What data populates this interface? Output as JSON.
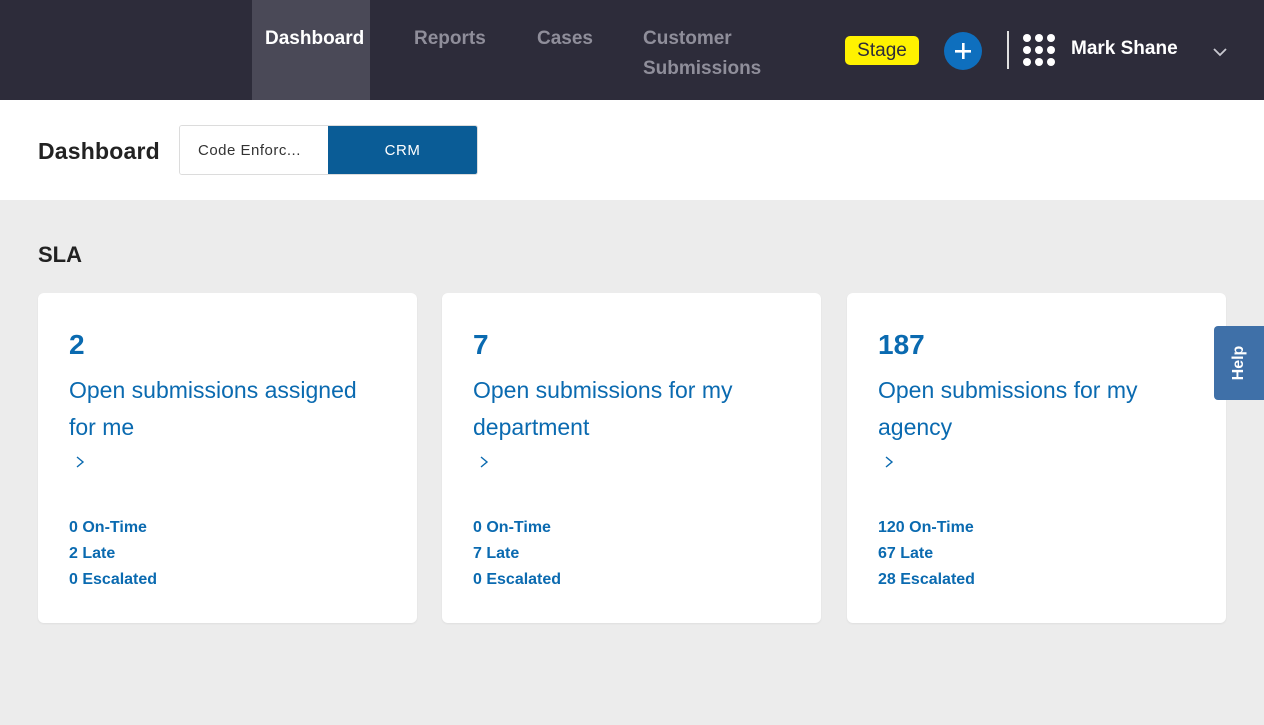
{
  "nav": {
    "tabs": [
      {
        "label": "Dashboard"
      },
      {
        "label": "Reports"
      },
      {
        "label": "Cases"
      },
      {
        "label": "Customer\nSubmissions"
      }
    ],
    "active_tab": "Dashboard",
    "env_badge": "Stage",
    "user_name": "Mark Shane",
    "icons": {
      "add": "plus-icon",
      "apps": "app-grid-icon",
      "menu": "chevron-down-icon"
    }
  },
  "subheader": {
    "title": "Dashboard",
    "segments": [
      {
        "label": "Code Enforc...",
        "selected": false
      },
      {
        "label": "CRM",
        "selected": true
      }
    ]
  },
  "section": {
    "title": "SLA"
  },
  "cards": [
    {
      "count": "2",
      "label": "Open submissions assigned for me",
      "on_time": "0 On-Time",
      "late": "2 Late",
      "escalated": "0 Escalated"
    },
    {
      "count": "7",
      "label": "Open submissions for my department",
      "on_time": "0 On-Time",
      "late": "7 Late",
      "escalated": "0 Escalated"
    },
    {
      "count": "187",
      "label": "Open submissions for my agency",
      "on_time": "120 On-Time",
      "late": "67 Late",
      "escalated": "28 Escalated"
    }
  ],
  "help": {
    "label": "Help"
  },
  "colors": {
    "nav_bg": "#2d2c3a",
    "accent_blue": "#0a6ab0",
    "segment_selected": "#0a5c96",
    "badge_yellow": "#fff200",
    "help_tab": "#3f70a8"
  }
}
